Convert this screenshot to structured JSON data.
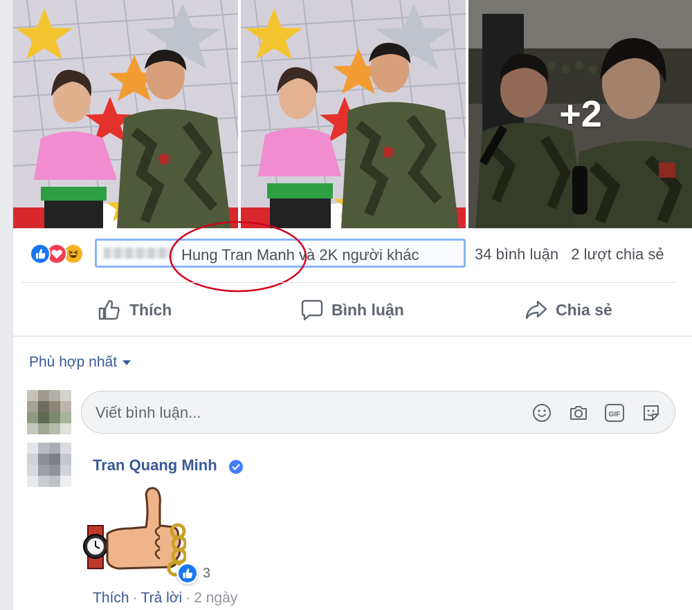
{
  "photos": {
    "more_count": "+2"
  },
  "reactions": {
    "icons": [
      "like-reaction-icon",
      "love-reaction-icon",
      "haha-reaction-icon"
    ],
    "names_text": "Hung Tran Manh và 2K người khác",
    "comment_count": "34 bình luận",
    "share_count": "2 lượt chia sẻ"
  },
  "actions": {
    "like": "Thích",
    "comment": "Bình luận",
    "share": "Chia sẻ"
  },
  "comments": {
    "sort_label": "Phù hợp nhất",
    "input_placeholder": "Viết bình luận...",
    "input_icons": [
      "emoji-icon",
      "camera-icon",
      "gif-icon",
      "sticker-icon"
    ],
    "first": {
      "author": "Tran Quang Minh",
      "verified": true,
      "reaction_count": "3",
      "like_label": "Thích",
      "reply_label": "Trả lời",
      "time": "2 ngày"
    }
  },
  "colors": {
    "link_blue": "#385898",
    "facebook_blue": "#1877f2",
    "love_red": "#f33e58",
    "haha_yellow": "#f7b125",
    "highlight_border": "#8ab4f8",
    "annotation_red": "#d0021b"
  }
}
